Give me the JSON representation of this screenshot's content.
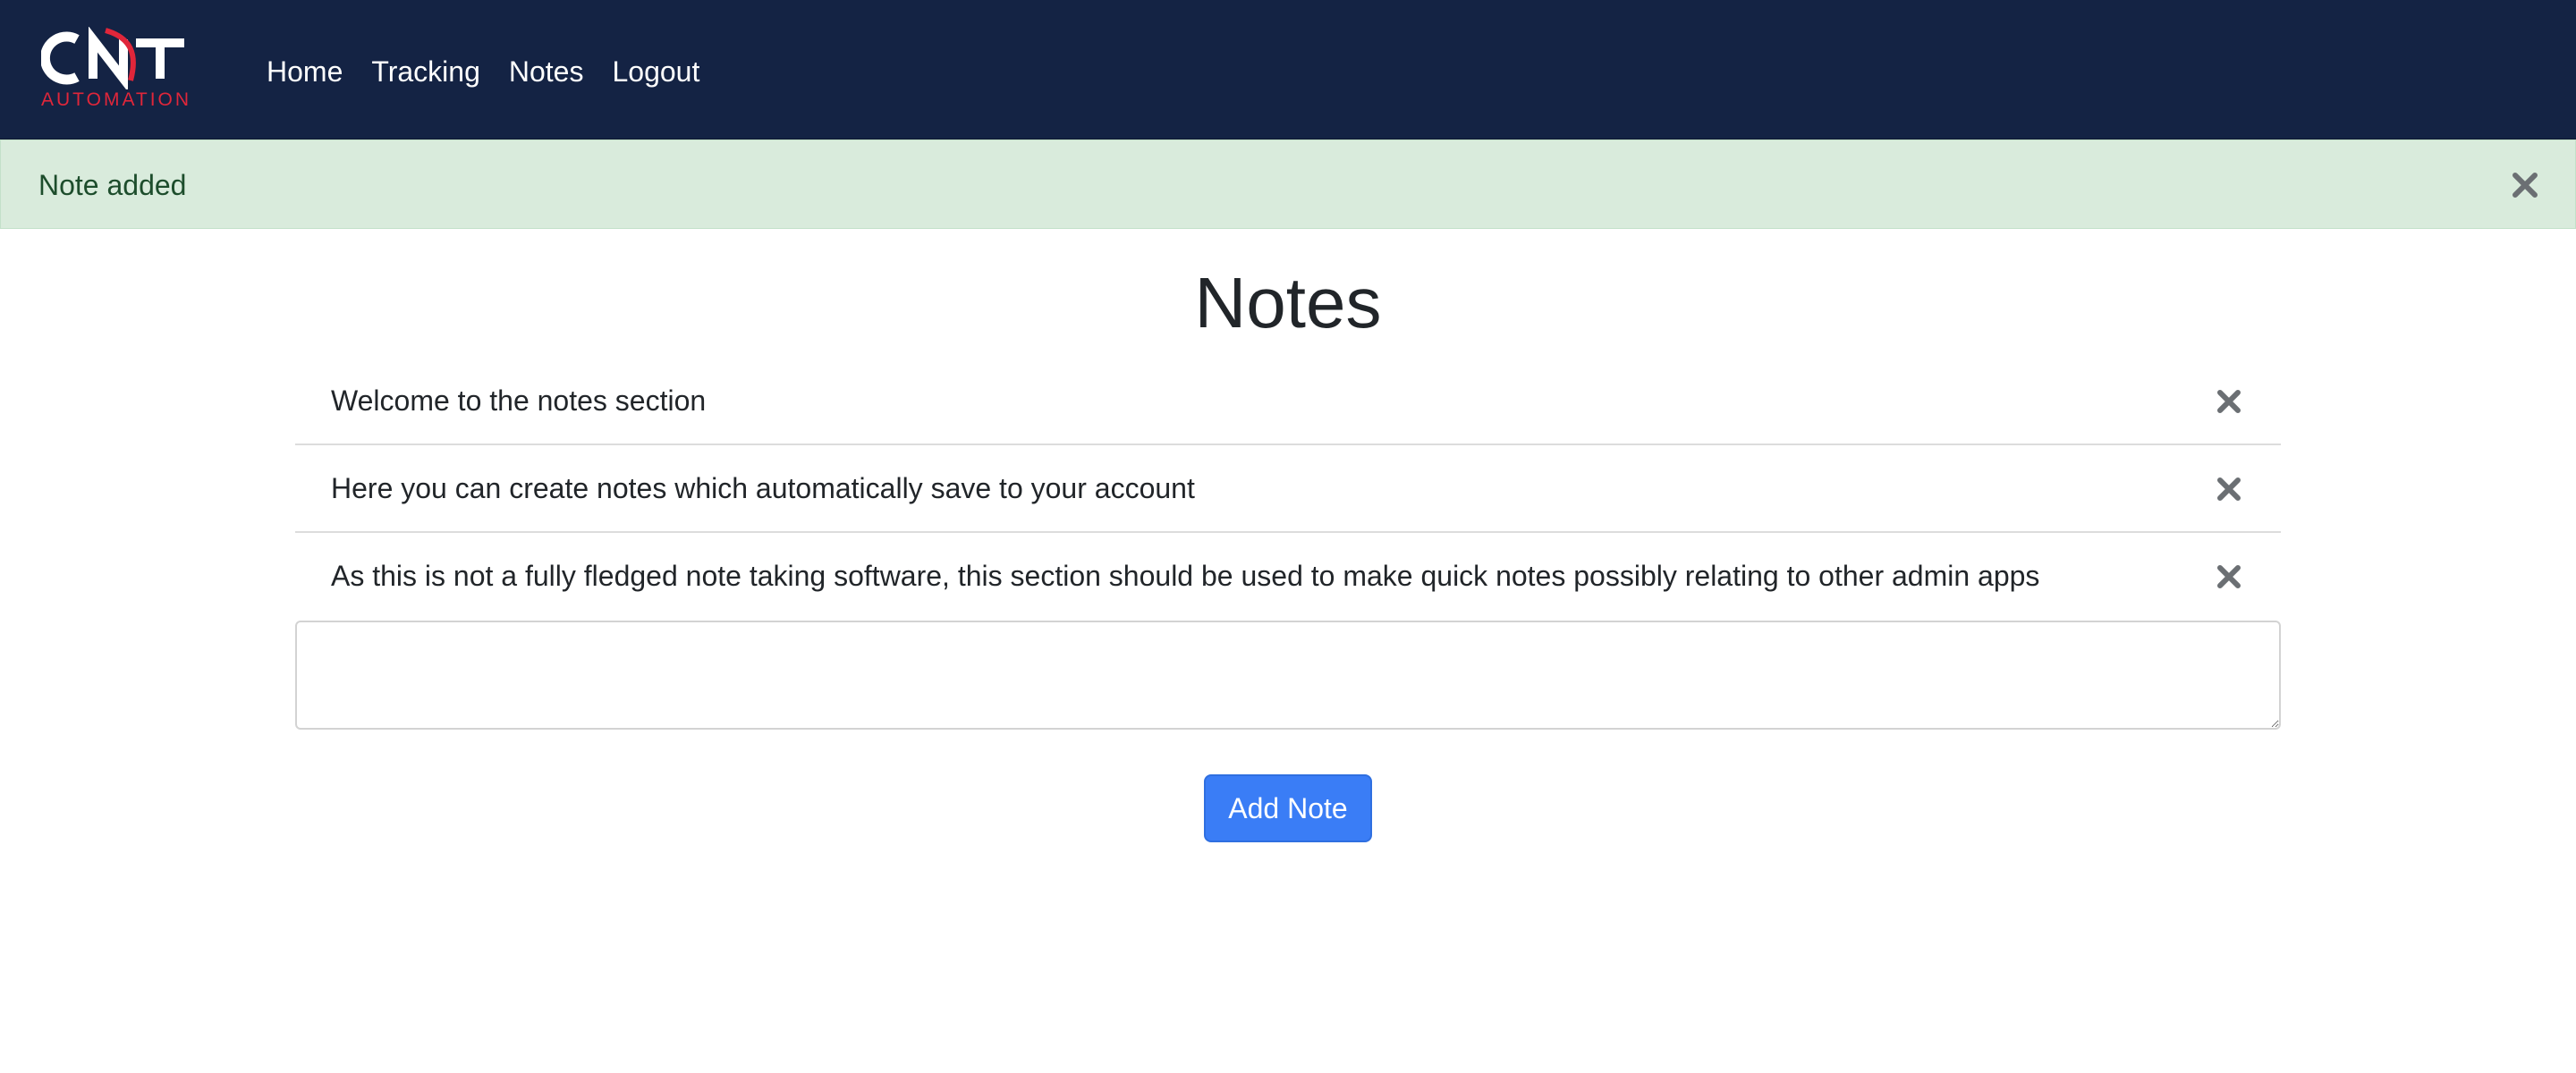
{
  "brand": {
    "logo_text": "CNT",
    "logo_subtext": "AUTOMATION",
    "accent_color": "#e0263a",
    "nav_bg_color": "#142344"
  },
  "nav": {
    "items": [
      {
        "label": "Home"
      },
      {
        "label": "Tracking"
      },
      {
        "label": "Notes"
      },
      {
        "label": "Logout"
      }
    ]
  },
  "alert": {
    "message": "Note added",
    "close_icon": "close-icon",
    "bg_color": "#d9ebdc"
  },
  "page": {
    "title": "Notes"
  },
  "notes": [
    {
      "text": "Welcome to the notes section",
      "delete_icon": "close-icon"
    },
    {
      "text": "Here you can create notes which automatically save to your account",
      "delete_icon": "close-icon"
    },
    {
      "text": "As this is not a fully fledged note taking software, this section should be used to make quick notes possibly relating to other admin apps",
      "delete_icon": "close-icon"
    }
  ],
  "note_form": {
    "input_value": "",
    "submit_label": "Add Note",
    "button_color": "#3a7df6"
  }
}
